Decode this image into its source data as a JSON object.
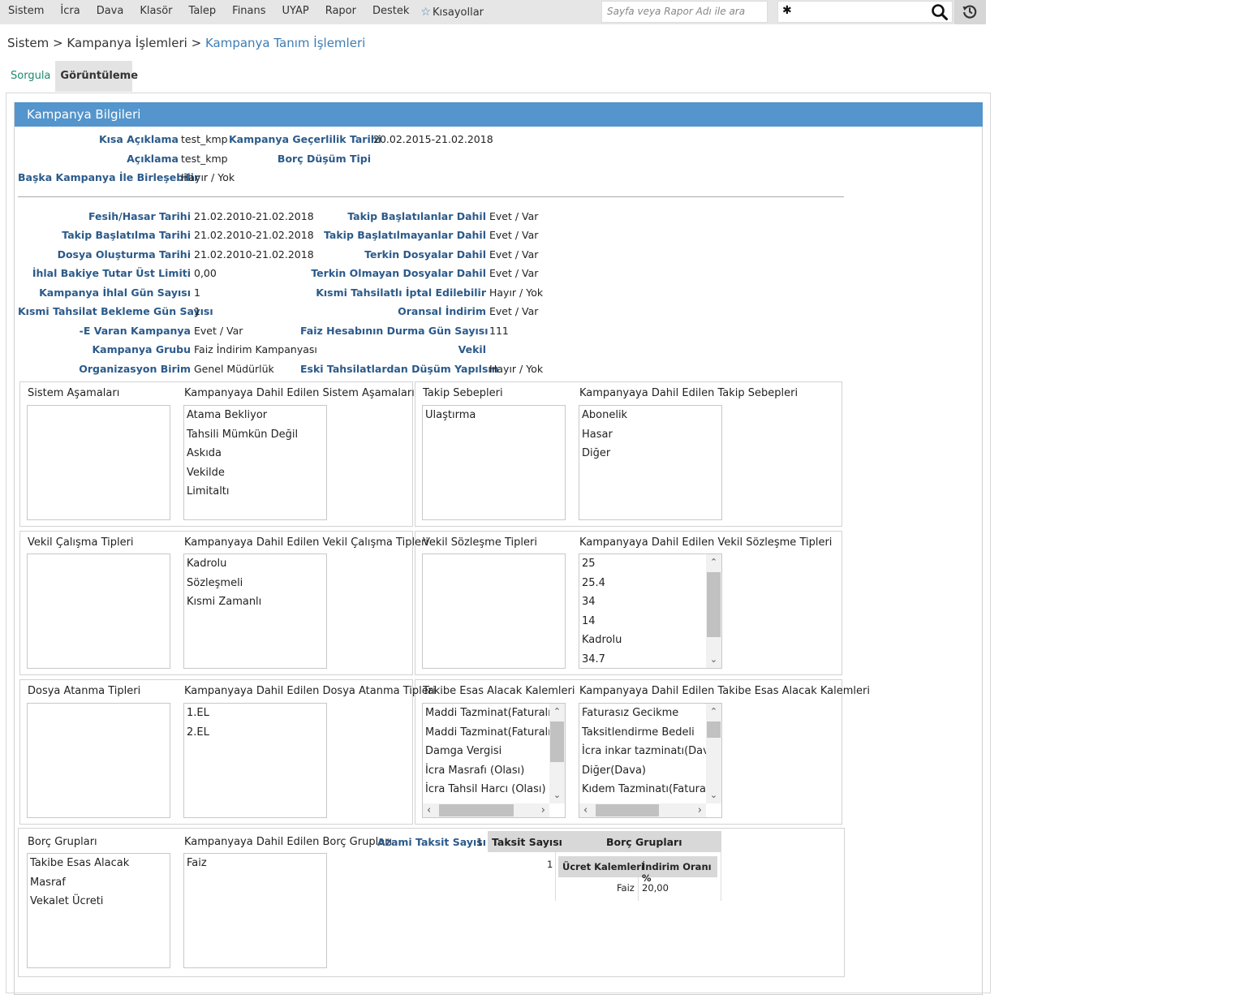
{
  "menu": [
    "Sistem",
    "İcra",
    "Dava",
    "Klasör",
    "Talep",
    "Finans",
    "UYAP",
    "Rapor",
    "Destek"
  ],
  "shortcuts": "Kısayollar",
  "search": {
    "placeholder": "Sayfa veya Rapor Adı ile ara"
  },
  "breadcrumb": {
    "a": "Sistem",
    "sep": ">",
    "b": "Kampanya İşlemleri",
    "c": "Kampanya Tanım İşlemleri"
  },
  "tabs": {
    "query": "Sorgula",
    "view": "Görüntüleme"
  },
  "panel_title": "Kampanya Bilgileri",
  "info": {
    "kisa_aciklama_l": "Kısa Açıklama",
    "kisa_aciklama_v": "test_kmp",
    "gecerlilik_l": "Kampanya Geçerlilik Tarihi",
    "gecerlilik_v": "20.02.2015-21.02.2018",
    "aciklama_l": "Açıklama",
    "aciklama_v": "test_kmp",
    "borc_dusum_l": "Borç Düşüm Tipi",
    "birlesebilir_l": "Başka Kampanya İle Birleşebilir",
    "birlesebilir_v": "Hayır / Yok"
  },
  "left_fields": [
    {
      "l": "Fesih/Hasar Tarihi",
      "v": "21.02.2010-21.02.2018"
    },
    {
      "l": "Takip Başlatılma Tarihi",
      "v": "21.02.2010-21.02.2018"
    },
    {
      "l": "Dosya Oluşturma Tarihi",
      "v": "21.02.2010-21.02.2018"
    },
    {
      "l": "İhlal Bakiye Tutar Üst Limiti",
      "v": "0,00"
    },
    {
      "l": "Kampanya İhlal Gün Sayısı",
      "v": "1"
    },
    {
      "l": "Kısmi Tahsilat Bekleme Gün Sayısı",
      "v": "1"
    },
    {
      "l": "-E Varan Kampanya",
      "v": "Evet / Var"
    },
    {
      "l": "Kampanya Grubu",
      "v": "Faiz İndirim Kampanyası"
    },
    {
      "l": "Organizasyon Birim",
      "v": "Genel Müdürlük"
    }
  ],
  "right_fields": [
    {
      "l": "Takip Başlatılanlar Dahil",
      "v": "Evet / Var"
    },
    {
      "l": "Takip Başlatılmayanlar Dahil",
      "v": "Evet / Var"
    },
    {
      "l": "Terkin Dosyalar Dahil",
      "v": "Evet / Var"
    },
    {
      "l": "Terkin Olmayan Dosyalar Dahil",
      "v": "Evet / Var"
    },
    {
      "l": "Kısmi Tahsilatlı İptal Edilebilir",
      "v": "Hayır / Yok"
    },
    {
      "l": "Oransal İndirim",
      "v": "Evet / Var"
    },
    {
      "l": "Faiz Hesabının Durma Gün Sayısı",
      "v": "111"
    },
    {
      "l": "Vekil",
      "v": ""
    },
    {
      "l": "Eski Tahsilatlardan Düşüm Yapılsın",
      "v": "Hayır / Yok"
    }
  ],
  "lists": {
    "sistem_asamalari": {
      "title": "Sistem Aşamaları",
      "items": []
    },
    "dahil_sistem_asamalari": {
      "title": "Kampanyaya Dahil Edilen Sistem Aşamaları",
      "items": [
        "Atama Bekliyor",
        "Tahsili Mümkün Değil",
        "Askıda",
        "Vekilde",
        "Limitaltı"
      ]
    },
    "takip_sebepleri": {
      "title": "Takip Sebepleri",
      "items": [
        "Ulaştırma"
      ]
    },
    "dahil_takip_sebepleri": {
      "title": "Kampanyaya Dahil Edilen Takip Sebepleri",
      "items": [
        "Abonelik",
        "Hasar",
        "Diğer"
      ]
    },
    "vekil_calisma": {
      "title": "Vekil Çalışma Tipleri",
      "items": []
    },
    "dahil_vekil_calisma": {
      "title": "Kampanyaya Dahil Edilen Vekil Çalışma Tipleri",
      "items": [
        "Kadrolu",
        "Sözleşmeli",
        "Kısmi Zamanlı"
      ]
    },
    "vekil_sozlesme": {
      "title": "Vekil Sözleşme Tipleri",
      "items": []
    },
    "dahil_vekil_sozlesme": {
      "title": "Kampanyaya Dahil Edilen Vekil Sözleşme Tipleri",
      "items": [
        "25",
        "25.4",
        "34",
        "14",
        "Kadrolu",
        "34.7"
      ]
    },
    "dosya_atanma": {
      "title": "Dosya Atanma Tipleri",
      "items": []
    },
    "dahil_dosya_atanma": {
      "title": "Kampanyaya Dahil Edilen Dosya Atanma Tipleri",
      "items": [
        "1.EL",
        "2.EL"
      ]
    },
    "takibe_esas": {
      "title": "Takibe Esas Alacak Kalemleri",
      "items": [
        "Maddi Tazminat(Faturalı)",
        "Maddi Tazminat(Faturalı-D",
        "Damga Vergisi",
        "İcra Masrafı (Olası)",
        "İcra Tahsil Harcı (Olası)"
      ]
    },
    "dahil_takibe_esas": {
      "title": "Kampanyaya Dahil Edilen Takibe Esas Alacak Kalemleri",
      "items": [
        "Faturasız Gecikme",
        "Taksitlendirme Bedeli",
        "İcra inkar tazminatı(Dava)",
        "Diğer(Dava)",
        "Kıdem Tazminatı(Faturası:"
      ]
    },
    "borc_gruplari": {
      "title": "Borç Grupları",
      "items": [
        "Takibe Esas Alacak",
        "Masraf",
        "Vekalet Ücreti"
      ]
    },
    "dahil_borc_gruplari": {
      "title": "Kampanyaya Dahil Edilen Borç Grupları",
      "items": [
        "Faiz"
      ]
    }
  },
  "azami": {
    "l": "Azami Taksit Sayısı",
    "v": "1"
  },
  "taksit_table": {
    "h1": "Taksit Sayısı",
    "h2": "Borç Grupları",
    "row_taksit": "1",
    "sub_h1": "Ücret Kalemleri",
    "sub_h2": "İndirim Oranı %",
    "sub_kalem": "Faiz",
    "sub_oran": "20,00"
  }
}
